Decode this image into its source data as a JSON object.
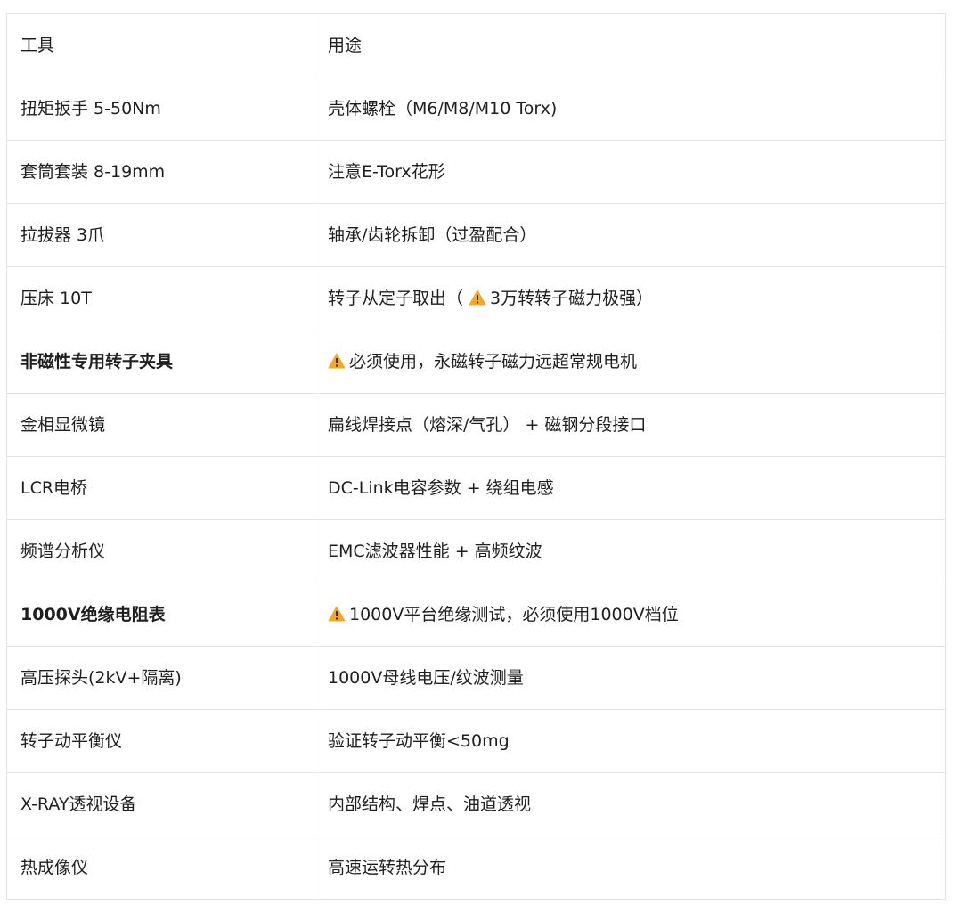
{
  "table": {
    "header": [
      "工具",
      "用途"
    ],
    "rows": [
      {
        "tool": "扭矩扳手 5-50Nm",
        "use_before": "壳体螺栓（M6/M8/M10 Torx)",
        "warning": false,
        "use_after": "",
        "bold": false
      },
      {
        "tool": "套筒套装 8-19mm",
        "use_before": "注意E-Torx花形",
        "warning": false,
        "use_after": "",
        "bold": false
      },
      {
        "tool": "拉拔器 3爪",
        "use_before": "轴承/齿轮拆卸（过盈配合）",
        "warning": false,
        "use_after": "",
        "bold": false
      },
      {
        "tool": "压床 10T",
        "use_before": "转子从定子取出（ ",
        "warning": true,
        "use_after": "3万转转子磁力极强）",
        "bold": false
      },
      {
        "tool": "非磁性专用转子夹具",
        "use_before": "",
        "warning": true,
        "use_after": "必须使用，永磁转子磁力远超常规电机",
        "bold": true
      },
      {
        "tool": "金相显微镜",
        "use_before": "扁线焊接点（熔深/气孔） + 磁钢分段接口",
        "warning": false,
        "use_after": "",
        "bold": false
      },
      {
        "tool": "LCR电桥",
        "use_before": "DC-Link电容参数 + 绕组电感",
        "warning": false,
        "use_after": "",
        "bold": false
      },
      {
        "tool": "频谱分析仪",
        "use_before": "EMC滤波器性能 + 高频纹波",
        "warning": false,
        "use_after": "",
        "bold": false
      },
      {
        "tool": "1000V绝缘电阻表",
        "use_before": "",
        "warning": true,
        "use_after": "1000V平台绝缘测试，必须使用1000V档位",
        "bold": true
      },
      {
        "tool": "高压探头(2kV+隔离)",
        "use_before": "1000V母线电压/纹波测量",
        "warning": false,
        "use_after": "",
        "bold": false
      },
      {
        "tool": "转子动平衡仪",
        "use_before": "验证转子动平衡<50mg",
        "warning": false,
        "use_after": "",
        "bold": false
      },
      {
        "tool": "X-RAY透视设备",
        "use_before": "内部结构、焊点、油道透视",
        "warning": false,
        "use_after": "",
        "bold": false
      },
      {
        "tool": "热成像仪",
        "use_before": "高速运转热分布",
        "warning": false,
        "use_after": "",
        "bold": false
      }
    ]
  },
  "icons": {
    "warning": "warning-icon"
  },
  "colors": {
    "border": "#e3e3e3",
    "text": "#1f1f1f",
    "warning_fill": "#f5a623"
  }
}
